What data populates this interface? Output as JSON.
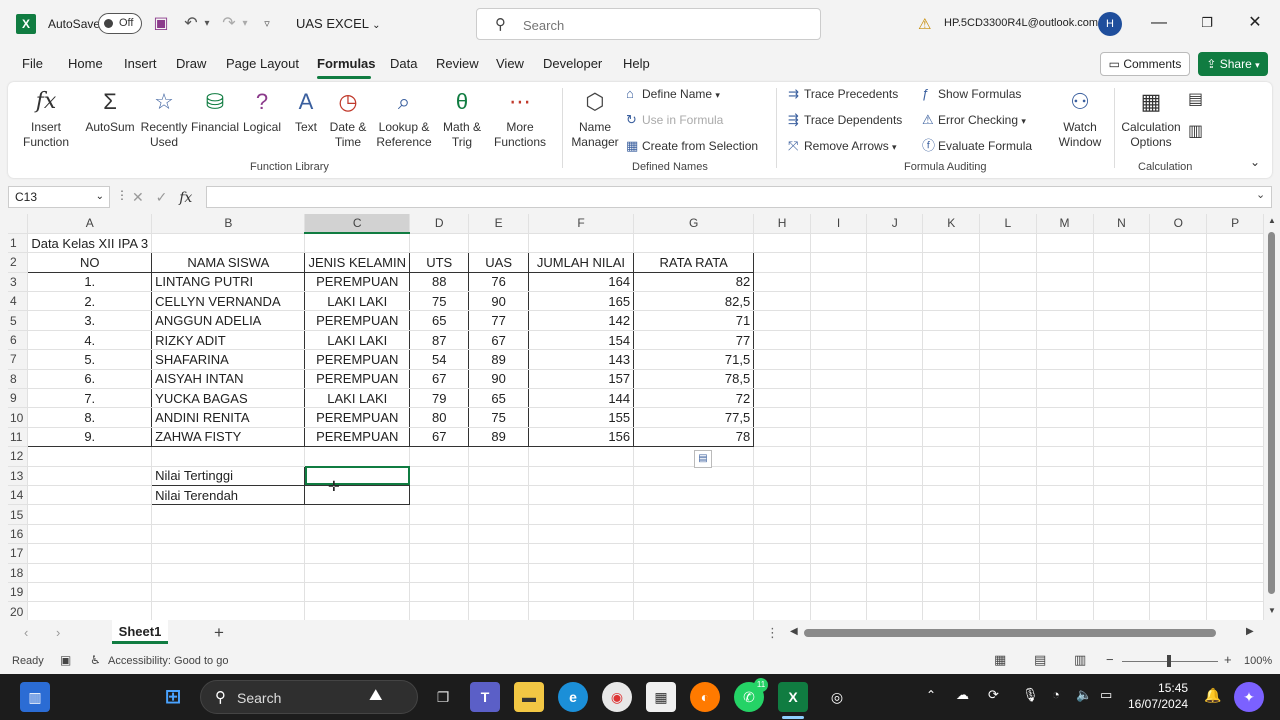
{
  "title_bar": {
    "autosave_label": "AutoSave",
    "autosave_state": "Off",
    "file_name": "UAS EXCEL",
    "search_placeholder": "Search",
    "account": "HP.5CD3300R4L@outlook.com",
    "avatar_initial": "H"
  },
  "menu": {
    "items": [
      "File",
      "Home",
      "Insert",
      "Draw",
      "Page Layout",
      "Formulas",
      "Data",
      "Review",
      "View",
      "Developer",
      "Help"
    ],
    "active": "Formulas",
    "comments_label": "Comments",
    "share_label": "Share"
  },
  "ribbon": {
    "function_library": {
      "label": "Function Library",
      "buttons": [
        "Insert Function",
        "AutoSum",
        "Recently Used",
        "Financial",
        "Logical",
        "Text",
        "Date & Time",
        "Lookup & Reference",
        "Math & Trig",
        "More Functions"
      ]
    },
    "defined_names": {
      "label": "Defined Names",
      "name_manager": "Name Manager",
      "define_name": "Define Name",
      "use_in_formula": "Use in Formula",
      "create_from_selection": "Create from Selection"
    },
    "formula_auditing": {
      "label": "Formula Auditing",
      "trace_precedents": "Trace Precedents",
      "trace_dependents": "Trace Dependents",
      "remove_arrows": "Remove Arrows",
      "show_formulas": "Show Formulas",
      "error_checking": "Error Checking",
      "evaluate_formula": "Evaluate Formula",
      "watch_window": "Watch Window"
    },
    "calculation": {
      "label": "Calculation",
      "calculation_options": "Calculation Options"
    }
  },
  "formula_bar": {
    "name_box": "C13",
    "fx": "fx",
    "value": ""
  },
  "grid": {
    "columns": [
      "A",
      "B",
      "C",
      "D",
      "E",
      "F",
      "G",
      "H",
      "I",
      "J",
      "K",
      "L",
      "M",
      "N",
      "O",
      "P"
    ],
    "selected_column": "C",
    "title": "Data Kelas XII IPA 3",
    "headers": [
      "NO",
      "NAMA SISWA",
      "JENIS KELAMIN",
      "UTS",
      "UAS",
      "JUMLAH NILAI",
      "RATA RATA"
    ],
    "rows": [
      [
        "1.",
        "LINTANG PUTRI",
        "PEREMPUAN",
        "88",
        "76",
        "164",
        "82"
      ],
      [
        "2.",
        "CELLYN VERNANDA",
        "LAKI LAKI",
        "75",
        "90",
        "165",
        "82,5"
      ],
      [
        "3.",
        "ANGGUN ADELIA",
        "PEREMPUAN",
        "65",
        "77",
        "142",
        "71"
      ],
      [
        "4.",
        "RIZKY ADIT",
        "LAKI LAKI",
        "87",
        "67",
        "154",
        "77"
      ],
      [
        "5.",
        "SHAFARINA",
        "PEREMPUAN",
        "54",
        "89",
        "143",
        "71,5"
      ],
      [
        "6.",
        "AISYAH INTAN",
        "PEREMPUAN",
        "67",
        "90",
        "157",
        "78,5"
      ],
      [
        "7.",
        "YUCKA BAGAS",
        "LAKI LAKI",
        "79",
        "65",
        "144",
        "72"
      ],
      [
        "8.",
        "ANDINI RENITA",
        "PEREMPUAN",
        "80",
        "75",
        "155",
        "77,5"
      ],
      [
        "9.",
        "ZAHWA FISTY",
        "PEREMPUAN",
        "67",
        "89",
        "156",
        "78"
      ]
    ],
    "summary": [
      "Nilai Tertinggi",
      "Nilai Terendah"
    ],
    "row_numbers": [
      "1",
      "2",
      "3",
      "4",
      "5",
      "6",
      "7",
      "8",
      "9",
      "10",
      "11",
      "12",
      "13",
      "14",
      "15",
      "16",
      "17",
      "18",
      "19",
      "20"
    ]
  },
  "sheets": {
    "active": "Sheet1"
  },
  "status_bar": {
    "ready": "Ready",
    "accessibility": "Accessibility: Good to go",
    "zoom": "100%"
  },
  "taskbar": {
    "search": "Search",
    "time": "15:45",
    "date": "16/07/2024",
    "whatsapp_badge": "11"
  }
}
